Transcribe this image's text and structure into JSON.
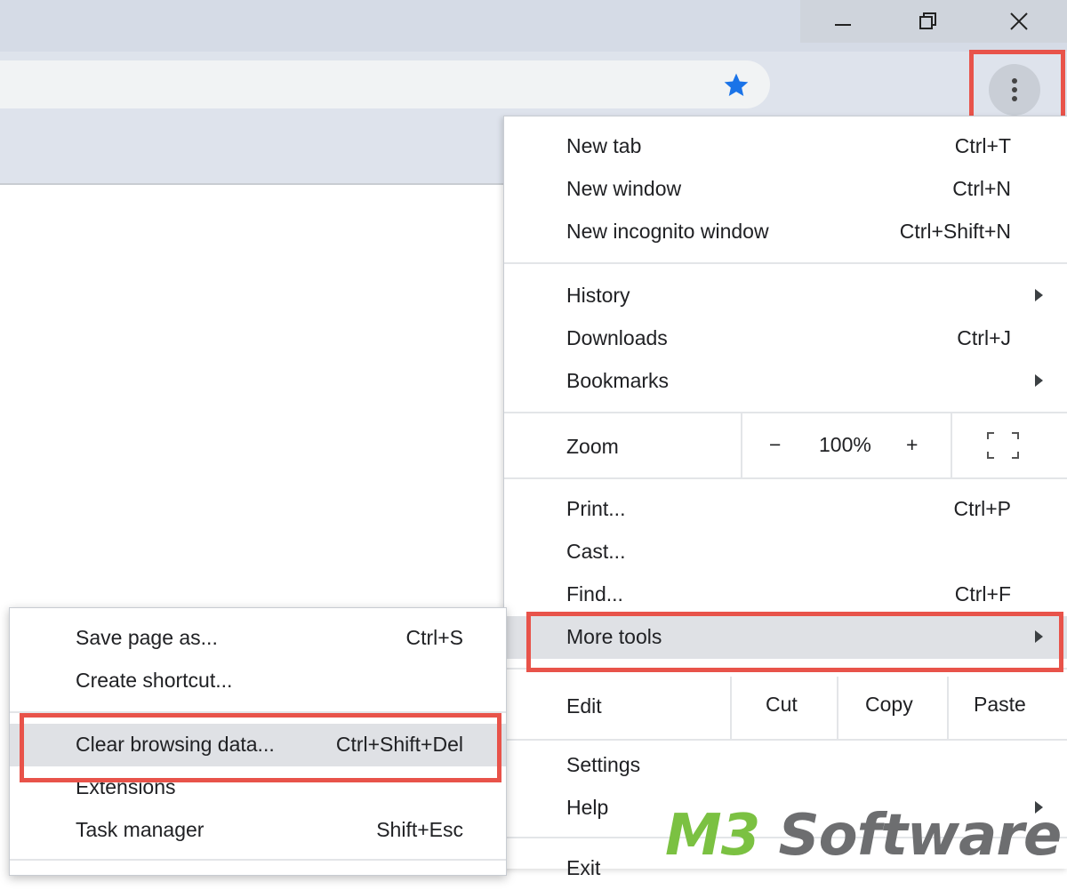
{
  "window_controls": {
    "minimize_icon": "minimize-icon",
    "restore_icon": "restore-icon",
    "close_icon": "close-icon"
  },
  "toolbar": {
    "bookmark_icon": "star-icon",
    "menu_icon": "vertical-dots-icon"
  },
  "main_menu": {
    "items": [
      {
        "label": "New tab",
        "shortcut": "Ctrl+T"
      },
      {
        "label": "New window",
        "shortcut": "Ctrl+N"
      },
      {
        "label": "New incognito window",
        "shortcut": "Ctrl+Shift+N"
      },
      {
        "label": "History",
        "shortcut": ""
      },
      {
        "label": "Downloads",
        "shortcut": "Ctrl+J"
      },
      {
        "label": "Bookmarks",
        "shortcut": ""
      },
      {
        "label": "Print...",
        "shortcut": "Ctrl+P"
      },
      {
        "label": "Cast...",
        "shortcut": ""
      },
      {
        "label": "Find...",
        "shortcut": "Ctrl+F"
      },
      {
        "label": "More tools",
        "shortcut": ""
      },
      {
        "label": "Settings",
        "shortcut": ""
      },
      {
        "label": "Help",
        "shortcut": ""
      },
      {
        "label": "Exit",
        "shortcut": ""
      }
    ],
    "zoom": {
      "label": "Zoom",
      "minus": "−",
      "value": "100%",
      "plus": "+",
      "fullscreen_icon": "fullscreen-icon"
    },
    "edit": {
      "label": "Edit",
      "cut": "Cut",
      "copy": "Copy",
      "paste": "Paste"
    }
  },
  "more_tools_submenu": {
    "items": [
      {
        "label": "Save page as...",
        "shortcut": "Ctrl+S"
      },
      {
        "label": "Create shortcut...",
        "shortcut": ""
      },
      {
        "label": "Clear browsing data...",
        "shortcut": "Ctrl+Shift+Del"
      },
      {
        "label": "Extensions",
        "shortcut": ""
      },
      {
        "label": "Task manager",
        "shortcut": "Shift+Esc"
      }
    ]
  },
  "watermark": {
    "part1": "M3",
    "part2": " Software"
  },
  "colors": {
    "highlight": "#e8534a",
    "star": "#1a73e8",
    "watermark_green": "#7bc142",
    "watermark_gray": "#6d6e70"
  }
}
